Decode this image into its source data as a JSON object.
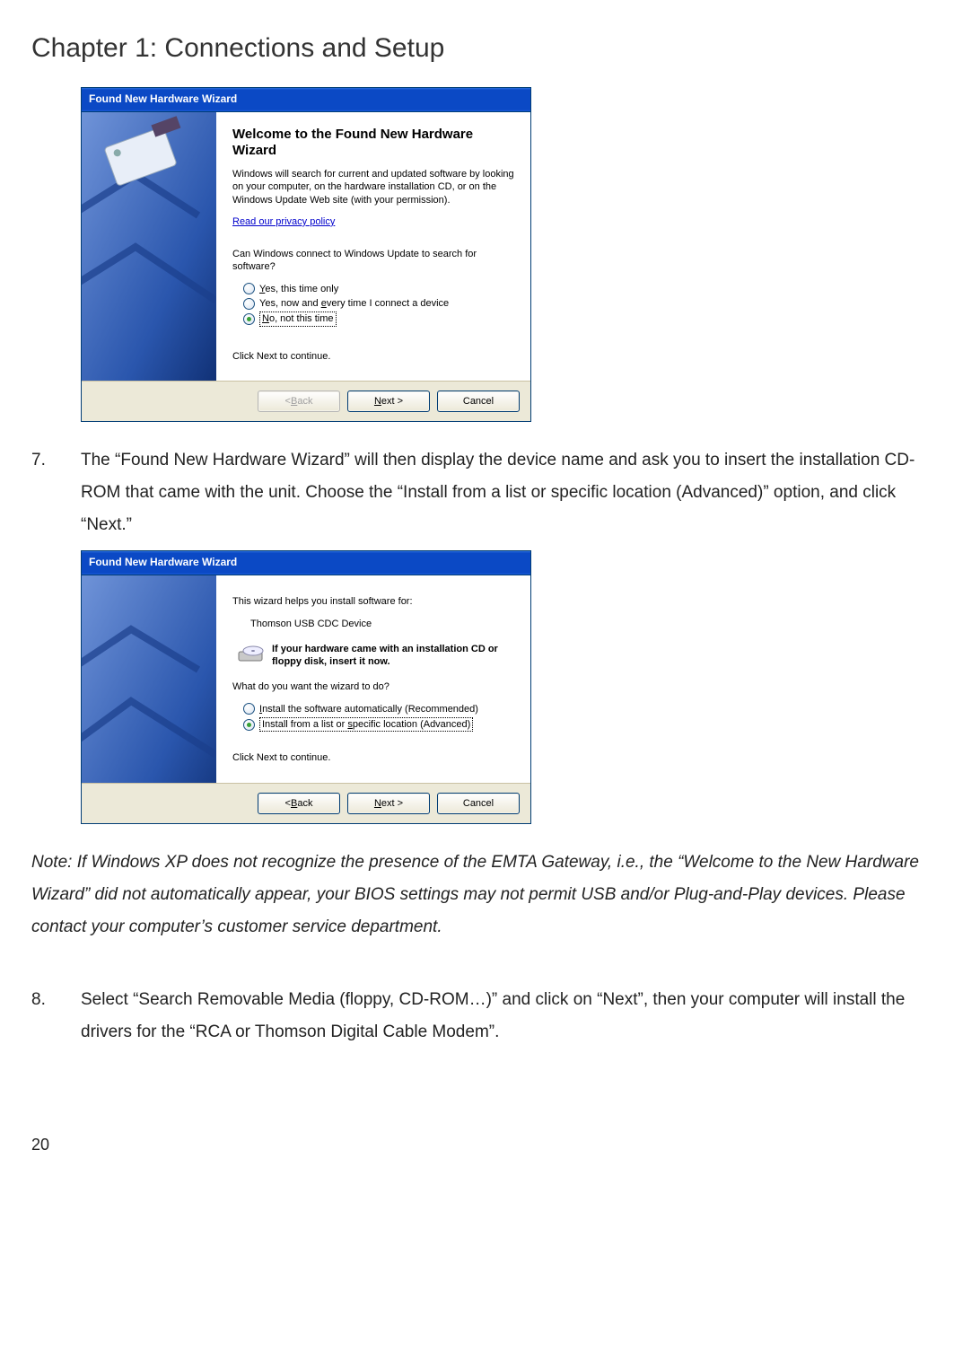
{
  "chapter_title": "Chapter 1: Connections and Setup",
  "page_number": "20",
  "wizard1": {
    "title": "Found New Hardware Wizard",
    "heading": "Welcome to the Found New Hardware Wizard",
    "intro": "Windows will search for current and updated software by looking on your computer, on the hardware installation CD, or on the Windows Update Web site (with your permission).",
    "privacy_link": "Read our privacy policy",
    "question": "Can Windows connect to Windows Update to search for software?",
    "opt1_pre": "Y",
    "opt1_rest": "es, this time only",
    "opt2a": "Yes, now and ",
    "opt2_u": "e",
    "opt2b": "very time I connect a device",
    "opt3_pre": "N",
    "opt3_rest": "o, not this time",
    "continue": "Click Next to continue.",
    "btn_back_pre": "< ",
    "btn_back_u": "B",
    "btn_back_post": "ack",
    "btn_next_u": "N",
    "btn_next_post": "ext >",
    "btn_cancel": "Cancel"
  },
  "step7": {
    "num": "7.",
    "text": "The “Found New Hardware Wizard” will then display the device name and ask you to insert the installation CD-ROM that came with the unit. Choose the “Install from a list or specific location (Advanced)” option, and click “Next.”"
  },
  "wizard2": {
    "title": "Found New Hardware Wizard",
    "helps": "This wizard helps you install software for:",
    "device": "Thomson USB CDC Device",
    "cd_note": "If your hardware came with an installation CD or floppy disk, insert it now.",
    "question": "What do you want the wizard to do?",
    "opt1_u": "I",
    "opt1_rest": "nstall the software automatically (Recommended)",
    "opt2a": "Install from a list or ",
    "opt2_u": "s",
    "opt2b": "pecific location (Advanced)",
    "continue": "Click Next to continue.",
    "btn_back_pre": "< ",
    "btn_back_u": "B",
    "btn_back_post": "ack",
    "btn_next_u": "N",
    "btn_next_post": "ext >",
    "btn_cancel": "Cancel"
  },
  "note": "Note: If Windows XP does not recognize the presence of the EMTA Gateway, i.e., the “Welcome to the New Hardware Wizard” did not automatically appear, your BIOS settings may not permit USB and/or Plug-and-Play devices. Please contact your computer’s customer service department.",
  "step8": {
    "num": "8.",
    "text": "Select “Search Removable Media (floppy, CD-ROM…)” and click on “Next”, then your computer will install the drivers for the “RCA or Thomson Digital Cable Modem”."
  }
}
